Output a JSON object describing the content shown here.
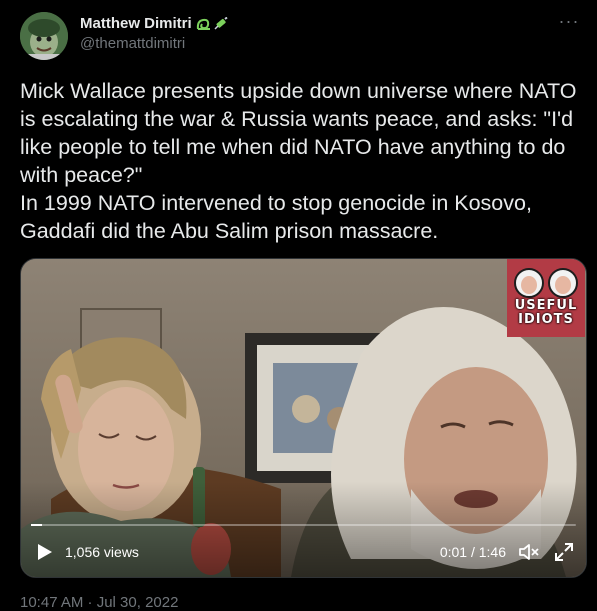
{
  "author": {
    "display_name": "Matthew Dimitri",
    "handle": "@themattdimitri",
    "name_emojis": [
      "slug-emoji",
      "syringe-emoji"
    ]
  },
  "tweet": {
    "paragraph_1": "Mick Wallace presents upside down universe where NATO is escalating the war & Russia wants peace, and asks: \"I'd like people to tell me when did NATO have anything to do with peace?\"",
    "paragraph_2": "In 1999 NATO intervened to stop genocide in Kosovo, Gaddafi did the Abu Salim prison massacre.",
    "timestamp": "10:47 AM · Jul 30, 2022"
  },
  "video": {
    "views": "1,056 views",
    "timecode": "0:01 / 1:46",
    "progress_fraction": 0.01,
    "watermark_line_1": "USEFUL",
    "watermark_line_2": "IDIOTS",
    "play_icon": "play-icon",
    "mute_icon": "speaker-muted-icon",
    "fullscreen_icon": "expand-icon"
  },
  "colors": {
    "background": "#000000",
    "text_primary": "#e7e9ea",
    "text_secondary": "#71767b",
    "border": "#2f3336"
  }
}
